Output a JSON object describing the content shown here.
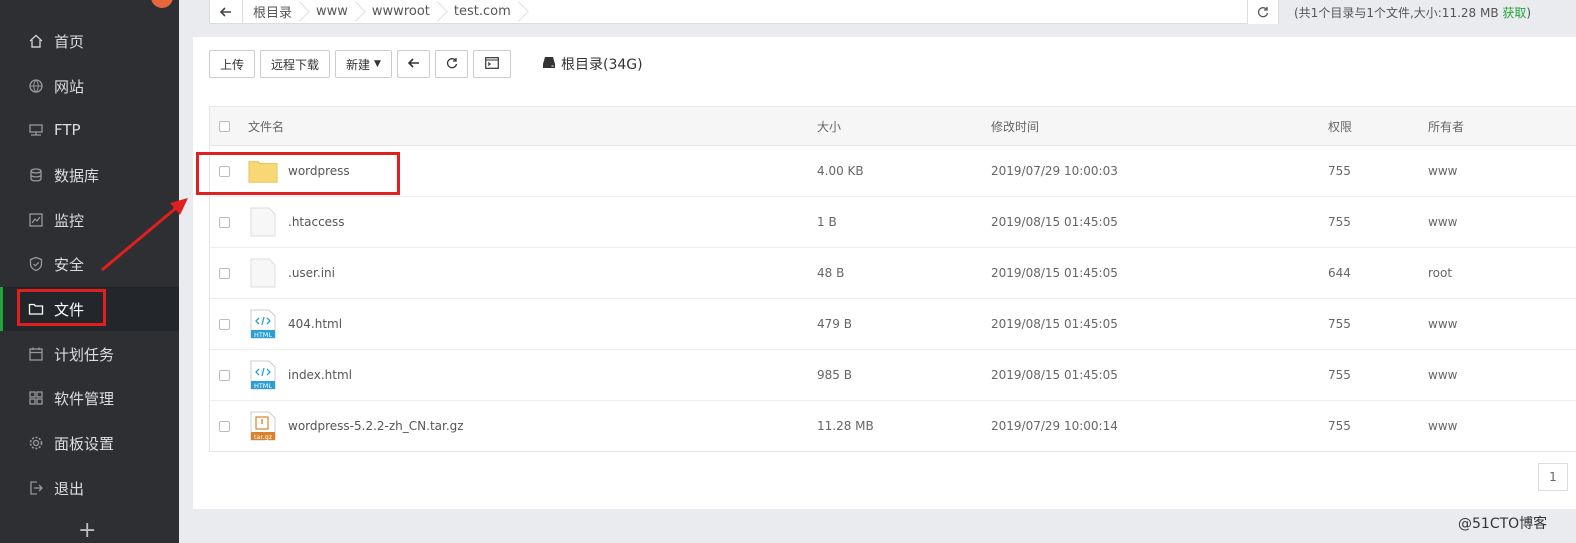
{
  "sidebar": {
    "items": [
      {
        "label": "首页",
        "icon": "home-icon"
      },
      {
        "label": "网站",
        "icon": "globe-icon"
      },
      {
        "label": "FTP",
        "icon": "ftp-icon"
      },
      {
        "label": "数据库",
        "icon": "database-icon"
      },
      {
        "label": "监控",
        "icon": "monitor-icon"
      },
      {
        "label": "安全",
        "icon": "shield-icon"
      },
      {
        "label": "文件",
        "icon": "folder-icon",
        "active": true
      },
      {
        "label": "计划任务",
        "icon": "calendar-icon"
      },
      {
        "label": "软件管理",
        "icon": "grid-icon"
      },
      {
        "label": "面板设置",
        "icon": "gear-icon"
      },
      {
        "label": "退出",
        "icon": "logout-icon"
      }
    ],
    "add_label": "+"
  },
  "breadcrumb": {
    "items": [
      "根目录",
      "www",
      "wwwroot",
      "test.com"
    ]
  },
  "dir_info": {
    "summary": "(共1个目录与1个文件,大小:11.28 MB ",
    "get_link": "获取",
    "close": ")"
  },
  "toolbar": {
    "upload": "上传",
    "remote_download": "远程下载",
    "new": "新建",
    "disk_label": "根目录(34G)"
  },
  "table": {
    "headers": {
      "name": "文件名",
      "size": "大小",
      "modified": "修改时间",
      "perm": "权限",
      "owner": "所有者"
    },
    "rows": [
      {
        "name": "wordpress",
        "type": "folder",
        "size": "4.00 KB",
        "modified": "2019/07/29 10:00:03",
        "perm": "755",
        "owner": "www"
      },
      {
        "name": ".htaccess",
        "type": "file",
        "size": "1 B",
        "modified": "2019/08/15 01:45:05",
        "perm": "755",
        "owner": "www"
      },
      {
        "name": ".user.ini",
        "type": "file",
        "size": "48 B",
        "modified": "2019/08/15 01:45:05",
        "perm": "644",
        "owner": "root"
      },
      {
        "name": "404.html",
        "type": "html",
        "size": "479 B",
        "modified": "2019/08/15 01:45:05",
        "perm": "755",
        "owner": "www"
      },
      {
        "name": "index.html",
        "type": "html",
        "size": "985 B",
        "modified": "2019/08/15 01:45:05",
        "perm": "755",
        "owner": "www"
      },
      {
        "name": "wordpress-5.2.2-zh_CN.tar.gz",
        "type": "targz",
        "size": "11.28 MB",
        "modified": "2019/07/29 10:00:14",
        "perm": "755",
        "owner": "www"
      }
    ]
  },
  "pager": {
    "current": "1"
  },
  "icon_text": {
    "html": "HTML",
    "targz": "tar.gz"
  },
  "watermark": "@51CTO博客",
  "colors": {
    "accent": "#20a53a",
    "annotation": "#e21f1f",
    "sidebar_bg": "#2d2f33"
  }
}
